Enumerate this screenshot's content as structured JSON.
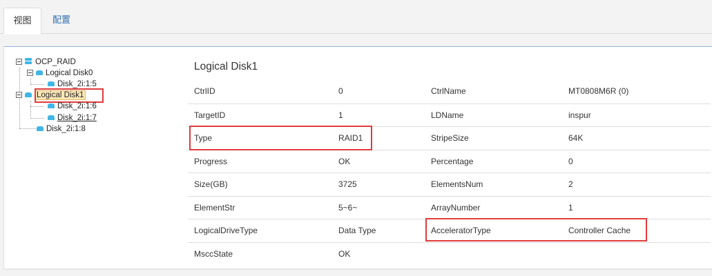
{
  "tabs": [
    {
      "label": "视图",
      "active": true
    },
    {
      "label": "配置",
      "active": false
    }
  ],
  "tree": {
    "root": "OCP_RAID",
    "logical_disk0": "Logical Disk0",
    "disk0_child": "Disk_2i:1:5",
    "logical_disk1": "Logical Disk1",
    "disk1_child_a": "Disk_2i:1:6",
    "disk1_child_b": "Disk_2i:1:7",
    "loose_disk": "Disk_2i:1:8"
  },
  "detail": {
    "title": "Logical Disk1",
    "rows": [
      {
        "k1": "CtrlID",
        "v1": "0",
        "k2": "CtrlName",
        "v2": "MT0808M6R (0)"
      },
      {
        "k1": "TargetID",
        "v1": "1",
        "k2": "LDName",
        "v2": "inspur"
      },
      {
        "k1": "Type",
        "v1": "RAID1",
        "k2": "StripeSize",
        "v2": "64K"
      },
      {
        "k1": "Progress",
        "v1": "OK",
        "k2": "Percentage",
        "v2": "0"
      },
      {
        "k1": "Size(GB)",
        "v1": "3725",
        "k2": "ElementsNum",
        "v2": "2"
      },
      {
        "k1": "ElementStr",
        "v1": "5~6~",
        "k2": "ArrayNumber",
        "v2": "1"
      },
      {
        "k1": "LogicalDriveType",
        "v1": "Data Type",
        "k2": "AcceleratorType",
        "v2": "Controller Cache"
      },
      {
        "k1": "MsccState",
        "v1": "OK",
        "k2": "",
        "v2": ""
      }
    ]
  },
  "colors": {
    "highlight": "#e03a3a",
    "link": "#2f6fb2",
    "disk_icon": "#3fb6e6"
  }
}
